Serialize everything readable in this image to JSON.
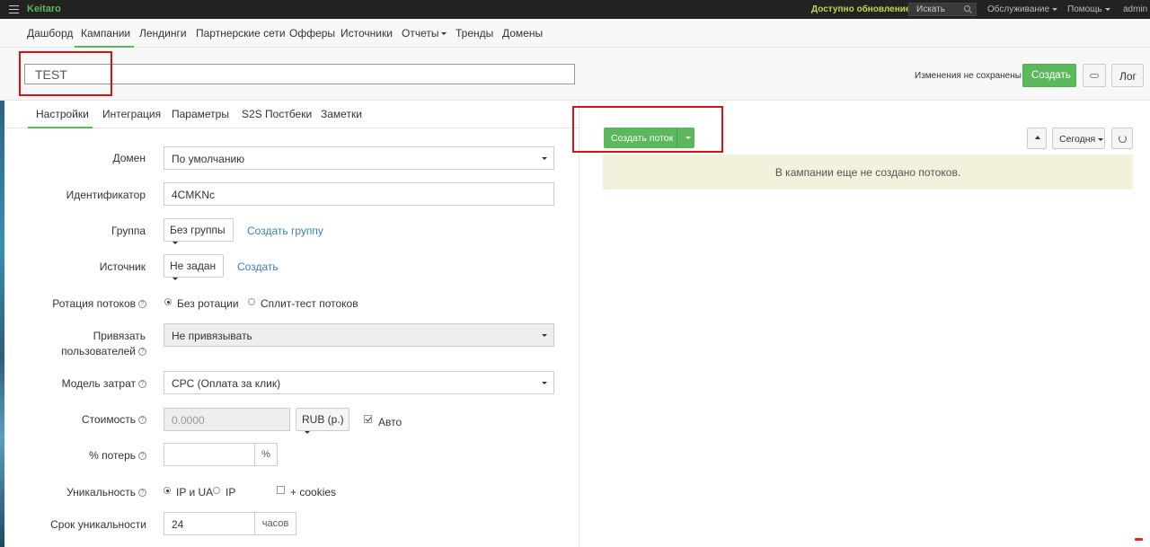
{
  "topbar": {
    "brand": "Keitaro",
    "update": "Доступно обновление!",
    "search_placeholder": "Искать",
    "menu": [
      "Обслуживание",
      "Помощь",
      "admin"
    ]
  },
  "nav": {
    "items": [
      "Дашборд",
      "Кампании",
      "Лендинги",
      "Партнерские сети",
      "Офферы",
      "Источники",
      "Отчеты",
      "Тренды",
      "Домены"
    ]
  },
  "campaign": {
    "name": "TEST",
    "unsaved": "Изменения не сохранены",
    "create_label": "Создать",
    "log_label": "Лог"
  },
  "tabs": [
    "Настройки",
    "Интеграция",
    "Параметры",
    "S2S Постбеки",
    "Заметки"
  ],
  "form": {
    "domain": {
      "label": "Домен",
      "value": "По умолчанию"
    },
    "identifier": {
      "label": "Идентификатор",
      "value": "4CMKNc"
    },
    "group": {
      "label": "Группа",
      "value": "Без группы",
      "link": "Создать группу"
    },
    "source": {
      "label": "Источник",
      "value": "Не задан",
      "link": "Создать"
    },
    "rotation": {
      "label": "Ротация потоков",
      "options": [
        "Без ротации",
        "Сплит-тест потоков"
      ]
    },
    "bind_users": {
      "label_line1": "Привязать",
      "label_line2": "пользователей",
      "value": "Не привязывать"
    },
    "cost_model": {
      "label": "Модель затрат",
      "value": "CPC (Оплата за клик)"
    },
    "cost": {
      "label": "Стоимость",
      "value": "0.0000",
      "currency": "RUB (р.)",
      "auto_label": "Авто"
    },
    "loss": {
      "label": "% потерь",
      "value": "",
      "suffix": "%"
    },
    "uniqueness": {
      "label": "Уникальность",
      "options": [
        "IP и UA",
        "IP"
      ],
      "cookies_label": "+ cookies"
    },
    "uniq_period": {
      "label": "Срок уникальности",
      "value": "24",
      "suffix": "часов"
    }
  },
  "streams": {
    "create_label": "Создать поток",
    "period": "Сегодня",
    "empty_message": "В кампании еще не создано потоков."
  }
}
